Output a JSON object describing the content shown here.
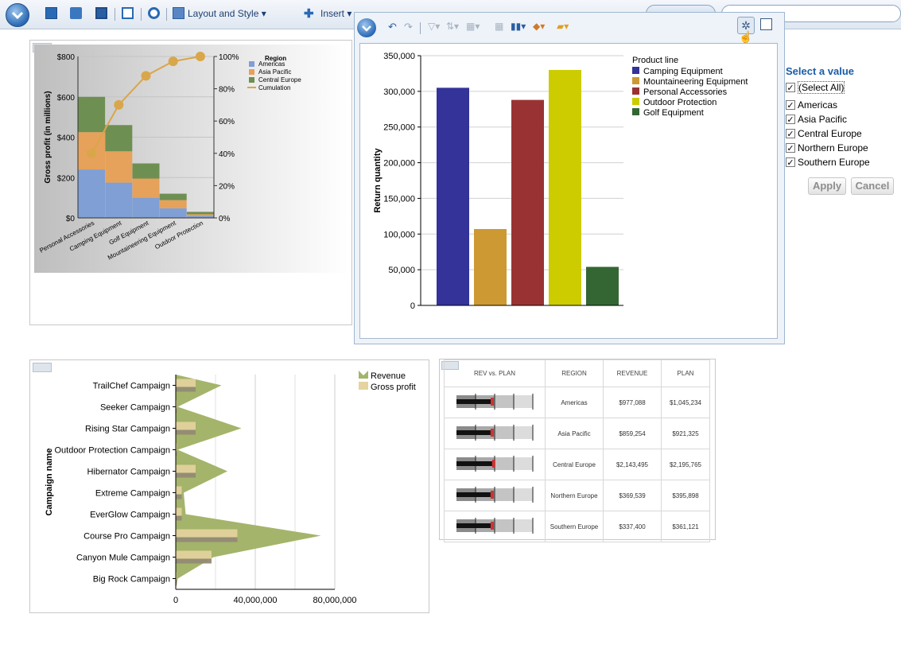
{
  "toolbar": {
    "layout_label": "Layout and Style ▾",
    "insert_label": "Insert ▾",
    "colors": {
      "accent": "#2a69b4",
      "toolbar_bg": "#dfe7f1",
      "link": "#1a5ea6"
    }
  },
  "pareto": {
    "chart_data": {
      "type": "bar",
      "categories": [
        "Personal Accessories",
        "Camping Equipment",
        "Golf Equipment",
        "Mountaineering Equipment",
        "Outdoor Protection"
      ],
      "series": [
        {
          "name": "Americas",
          "values": [
            240,
            175,
            100,
            48,
            10
          ],
          "color": "#7f9fd5"
        },
        {
          "name": "Asia Pacific",
          "values": [
            185,
            155,
            95,
            40,
            8
          ],
          "color": "#e6a15a"
        },
        {
          "name": "Central Europe",
          "values": [
            175,
            130,
            75,
            32,
            12
          ],
          "color": "#6e8f52"
        },
        {
          "name": "Cumulation",
          "values": [
            40,
            70,
            88,
            97,
            100
          ],
          "color": "#d9a649"
        }
      ],
      "ylabel": "Gross profit (in millions)",
      "y_ticks": [
        "$0",
        "$200",
        "$400",
        "$600",
        "$800"
      ],
      "y2_ticks": [
        "0%",
        "20%",
        "40%",
        "60%",
        "80%",
        "100%"
      ],
      "ylim": [
        0,
        800
      ],
      "y2lim": [
        0,
        100
      ],
      "legend_title": "Region",
      "legend_position": "top-right",
      "grid": true
    }
  },
  "returns": {
    "chart_data": {
      "type": "bar",
      "categories": [
        "Camping Equipment",
        "Mountaineering Equipment",
        "Personal Accessories",
        "Outdoor Protection",
        "Golf Equipment"
      ],
      "values": [
        305000,
        107000,
        288000,
        330000,
        54000
      ],
      "colors": [
        "#33339a",
        "#cc9933",
        "#993333",
        "#cccc00",
        "#336633"
      ],
      "ylabel": "Return quantity",
      "ylim": [
        0,
        350000
      ],
      "y_ticks": [
        "0",
        "50,000",
        "100,000",
        "150,000",
        "200,000",
        "250,000",
        "300,000",
        "350,000"
      ],
      "legend_title": "Product line",
      "legend_position": "top-right",
      "grid": true
    }
  },
  "filter": {
    "title": "Select a value",
    "items": [
      {
        "label": "(Select All)",
        "checked": true
      },
      {
        "label": "Americas",
        "checked": true
      },
      {
        "label": "Asia Pacific",
        "checked": true
      },
      {
        "label": "Central Europe",
        "checked": true
      },
      {
        "label": "Northern Europe",
        "checked": true
      },
      {
        "label": "Southern Europe",
        "checked": true
      }
    ],
    "apply_label": "Apply",
    "cancel_label": "Cancel"
  },
  "campaigns": {
    "chart_data": {
      "type": "area",
      "categories": [
        "TrailChef Campaign",
        "Seeker Campaign",
        "Rising Star Campaign",
        "Outdoor Protection Campaign",
        "Hibernator Campaign",
        "Extreme Campaign",
        "EverGlow Campaign",
        "Course Pro Campaign",
        "Canyon Mule Campaign",
        "Big Rock Campaign"
      ],
      "series": [
        {
          "name": "Revenue",
          "values": [
            23000000,
            1000000,
            33000000,
            1000000,
            26000000,
            4000000,
            5000000,
            73000000,
            19000000,
            1000000
          ],
          "color": "#a4b46a"
        },
        {
          "name": "Gross profit",
          "values": [
            10000000,
            500000,
            10000000,
            500000,
            10000000,
            3000000,
            3000000,
            31000000,
            18000000,
            500000
          ],
          "color": "#e6d3a0"
        }
      ],
      "ylabel": "Campaign name",
      "x_ticks": [
        "0",
        "40,000,000",
        "80,000,000"
      ],
      "xlim": [
        0,
        80000000
      ],
      "legend_position": "top-right",
      "grid": true
    }
  },
  "bullet_table": {
    "headers": [
      "REV vs. PLAN",
      "REGION",
      "REVENUE",
      "PLAN"
    ],
    "rows": [
      {
        "region": "Americas",
        "revenue": "$977,088",
        "plan": "$1,045,234",
        "ratio": 0.935
      },
      {
        "region": "Asia Pacific",
        "revenue": "$859,254",
        "plan": "$921,325",
        "ratio": 0.933
      },
      {
        "region": "Central Europe",
        "revenue": "$2,143,495",
        "plan": "$2,195,765",
        "ratio": 0.976
      },
      {
        "region": "Northern Europe",
        "revenue": "$369,539",
        "plan": "$395,898",
        "ratio": 0.933
      },
      {
        "region": "Southern Europe",
        "revenue": "$337,400",
        "plan": "$361,121",
        "ratio": 0.934
      }
    ]
  }
}
